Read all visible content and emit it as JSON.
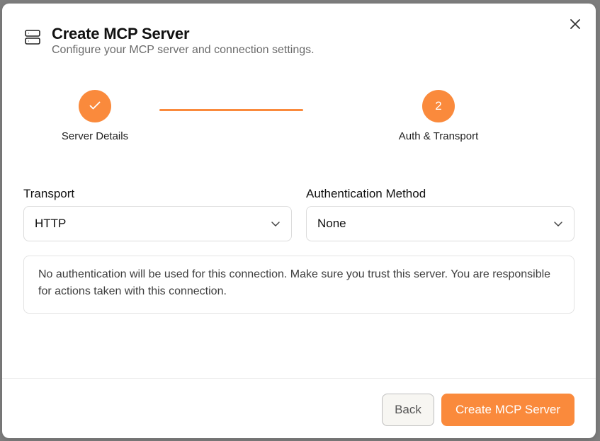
{
  "dialog": {
    "title": "Create MCP Server",
    "subtitle": "Configure your MCP server and connection settings."
  },
  "stepper": {
    "steps": [
      {
        "label": "Server Details",
        "state": "completed",
        "marker": "✓"
      },
      {
        "label": "Auth & Transport",
        "state": "active",
        "marker": "2"
      }
    ],
    "accent_color": "#fa8a3c"
  },
  "form": {
    "transport": {
      "label": "Transport",
      "value": "HTTP"
    },
    "auth_method": {
      "label": "Authentication Method",
      "value": "None"
    }
  },
  "info": {
    "text": "No authentication will be used for this connection. Make sure you trust this server. You are responsible for actions taken with this connection."
  },
  "footer": {
    "back_label": "Back",
    "create_label": "Create MCP Server"
  },
  "icons": {
    "header": "server-icon",
    "close": "close-icon",
    "chevron": "chevron-down-icon",
    "check": "check-icon"
  }
}
